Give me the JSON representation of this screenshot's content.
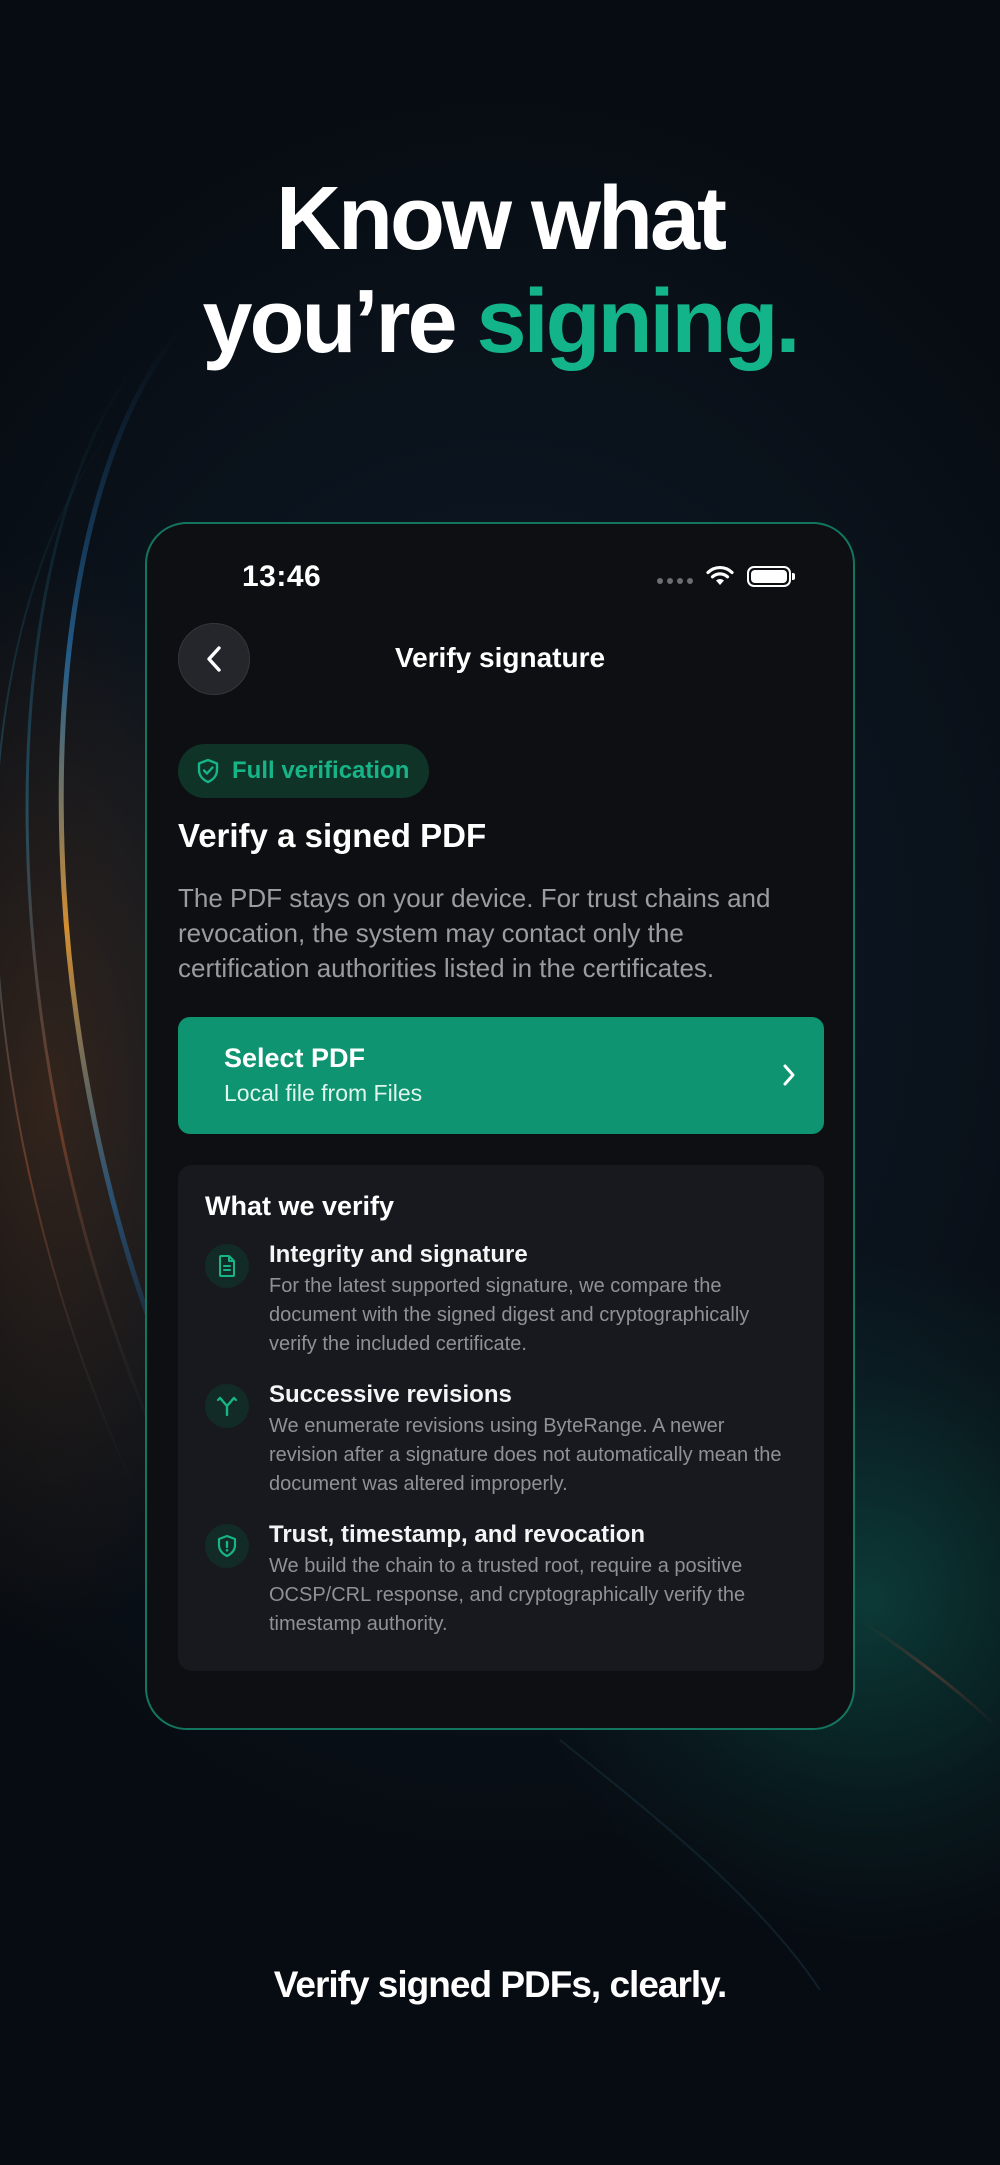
{
  "headline": {
    "line1": "Know what",
    "line2_prefix": "you’re ",
    "line2_accent": "signing."
  },
  "status_bar": {
    "time": "13:46"
  },
  "nav": {
    "title": "Verify signature"
  },
  "badge": {
    "label": "Full verification"
  },
  "section": {
    "title": "Verify a signed PDF",
    "description": "The PDF stays on your device. For trust chains and revocation, the system may contact only the certification authorities listed in the certificates."
  },
  "select_pdf": {
    "title": "Select PDF",
    "subtitle": "Local file from Files"
  },
  "verify_card": {
    "title": "What we verify",
    "items": [
      {
        "icon": "document-icon",
        "title": "Integrity and signature",
        "description": "For the latest supported signature, we compare the document with the signed digest and cryptographically verify the included certificate."
      },
      {
        "icon": "branch-icon",
        "title": "Successive revisions",
        "description": "We enumerate revisions using ByteRange. A newer revision after a signature does not automatically mean the document was altered improperly."
      },
      {
        "icon": "shield-icon",
        "title": "Trust, timestamp, and revocation",
        "description": "We build the chain to a trusted root, require a positive OCSP/CRL response, and cryptographically verify the timestamp authority."
      }
    ]
  },
  "tagline": "Verify signed PDFs, clearly.",
  "colors": {
    "accent": "#13b48a",
    "button": "#0e9470",
    "background": "#0a111a",
    "phone_border": "#14755e"
  }
}
